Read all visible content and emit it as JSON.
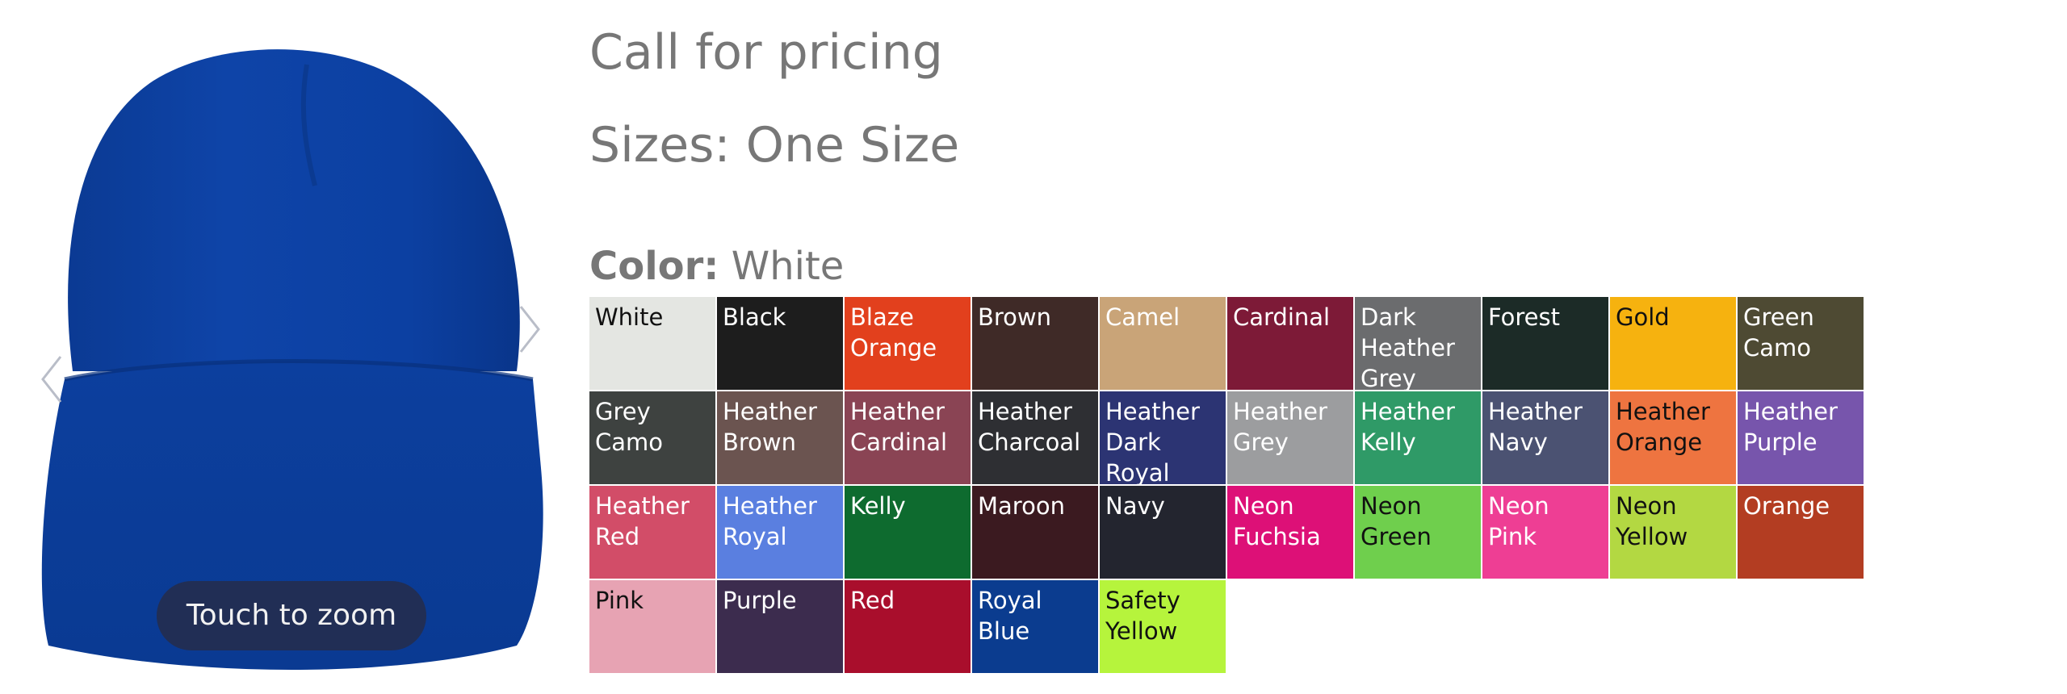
{
  "gallery": {
    "zoom_label": "Touch to zoom",
    "product_color": "#0a3fa0"
  },
  "product": {
    "price_text": "Call for pricing",
    "sizes_text": "Sizes: One Size",
    "color_label": "Color:",
    "selected_color": "White"
  },
  "swatches": [
    {
      "label": "White",
      "bg": "#e4e6e2",
      "fg": "#111111"
    },
    {
      "label": "Black",
      "bg": "#1d1d1d",
      "fg": "#ffffff"
    },
    {
      "label": "Blaze Orange",
      "bg": "#e2401d",
      "fg": "#ffffff"
    },
    {
      "label": "Brown",
      "bg": "#3f2a27",
      "fg": "#ffffff"
    },
    {
      "label": "Camel",
      "bg": "#c9a478",
      "fg": "#ffffff"
    },
    {
      "label": "Cardinal",
      "bg": "#7d1a37",
      "fg": "#ffffff"
    },
    {
      "label": "Dark Heather Grey",
      "bg": "#6b6c6e",
      "fg": "#ffffff"
    },
    {
      "label": "Forest",
      "bg": "#1c2b27",
      "fg": "#ffffff"
    },
    {
      "label": "Gold",
      "bg": "#f6b20f",
      "fg": "#111111"
    },
    {
      "label": "Green Camo",
      "bg": "#4e4a33",
      "fg": "#ffffff"
    },
    {
      "label": "Grey Camo",
      "bg": "#3e4240",
      "fg": "#ffffff"
    },
    {
      "label": "Heather Brown",
      "bg": "#6b5450",
      "fg": "#ffffff"
    },
    {
      "label": "Heather Cardinal",
      "bg": "#8a4454",
      "fg": "#ffffff"
    },
    {
      "label": "Heather Charcoal",
      "bg": "#2e2f33",
      "fg": "#ffffff"
    },
    {
      "label": "Heather Dark Royal",
      "bg": "#2c3473",
      "fg": "#ffffff"
    },
    {
      "label": "Heather Grey",
      "bg": "#9c9d9f",
      "fg": "#ffffff"
    },
    {
      "label": "Heather Kelly",
      "bg": "#2f9a67",
      "fg": "#ffffff"
    },
    {
      "label": "Heather Navy",
      "bg": "#4b5272",
      "fg": "#ffffff"
    },
    {
      "label": "Heather Orange",
      "bg": "#ee7440",
      "fg": "#111111"
    },
    {
      "label": "Heather Purple",
      "bg": "#7755ac",
      "fg": "#ffffff"
    },
    {
      "label": "Heather Red",
      "bg": "#d24d68",
      "fg": "#ffffff"
    },
    {
      "label": "Heather Royal",
      "bg": "#5a7fe0",
      "fg": "#ffffff"
    },
    {
      "label": "Kelly",
      "bg": "#0e6b2f",
      "fg": "#ffffff"
    },
    {
      "label": "Maroon",
      "bg": "#3b1a20",
      "fg": "#ffffff"
    },
    {
      "label": "Navy",
      "bg": "#23252f",
      "fg": "#ffffff"
    },
    {
      "label": "Neon Fuchsia",
      "bg": "#dd1077",
      "fg": "#ffffff"
    },
    {
      "label": "Neon Green",
      "bg": "#6fcf4d",
      "fg": "#111111"
    },
    {
      "label": "Neon Pink",
      "bg": "#ee3e94",
      "fg": "#ffffff"
    },
    {
      "label": "Neon Yellow",
      "bg": "#b3d842",
      "fg": "#111111"
    },
    {
      "label": "Orange",
      "bg": "#b33d22",
      "fg": "#ffffff"
    },
    {
      "label": "Pink",
      "bg": "#e7a3b3",
      "fg": "#111111"
    },
    {
      "label": "Purple",
      "bg": "#3c2c4e",
      "fg": "#ffffff"
    },
    {
      "label": "Red",
      "bg": "#a90e2c",
      "fg": "#ffffff"
    },
    {
      "label": "Royal Blue",
      "bg": "#0b3c8f",
      "fg": "#ffffff"
    },
    {
      "label": "Safety Yellow",
      "bg": "#b6f43c",
      "fg": "#111111"
    }
  ]
}
